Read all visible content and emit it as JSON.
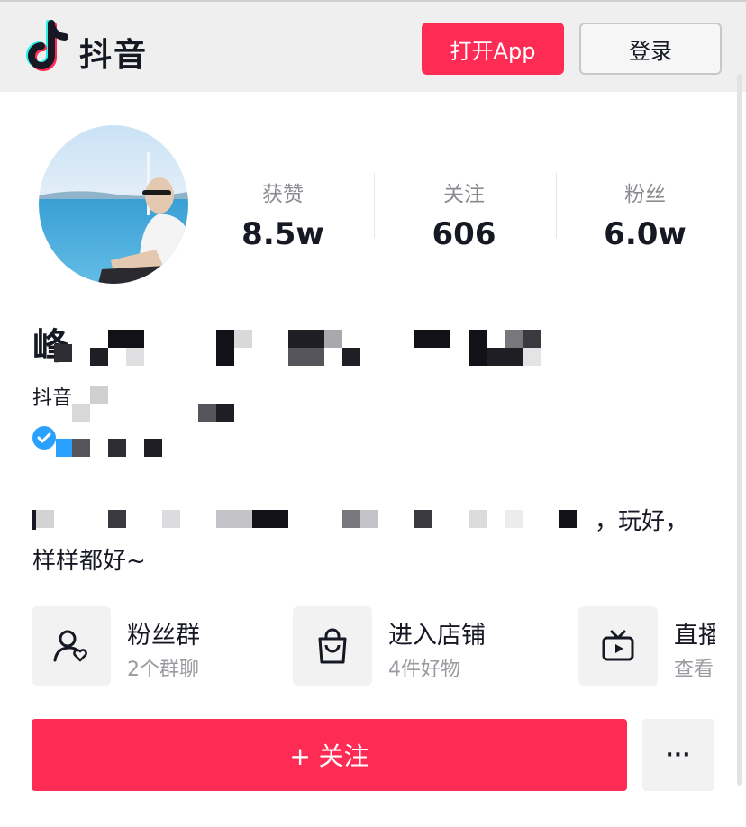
{
  "header": {
    "brand": "抖音",
    "open_app_label": "打开App",
    "login_label": "登录"
  },
  "profile": {
    "name_visible": "峰",
    "douyin_id_prefix": "抖音",
    "stats": [
      {
        "label": "获赞",
        "value": "8.5w"
      },
      {
        "label": "关注",
        "value": "606"
      },
      {
        "label": "粉丝",
        "value": "6.0w"
      }
    ]
  },
  "bio": {
    "line1_end": "，玩好，",
    "line2": "样样都好~"
  },
  "entries": [
    {
      "title": "粉丝群",
      "subtitle": "2个群聊",
      "icon": "fan-group-icon"
    },
    {
      "title": "进入店铺",
      "subtitle": "4件好物",
      "icon": "shopping-bag-icon"
    },
    {
      "title": "直播",
      "subtitle": "查看",
      "icon": "tv-icon"
    }
  ],
  "actions": {
    "follow_label": "+ 关注",
    "more_label": "···"
  },
  "colors": {
    "accent": "#fe2c55",
    "verified": "#2ba1ff"
  }
}
